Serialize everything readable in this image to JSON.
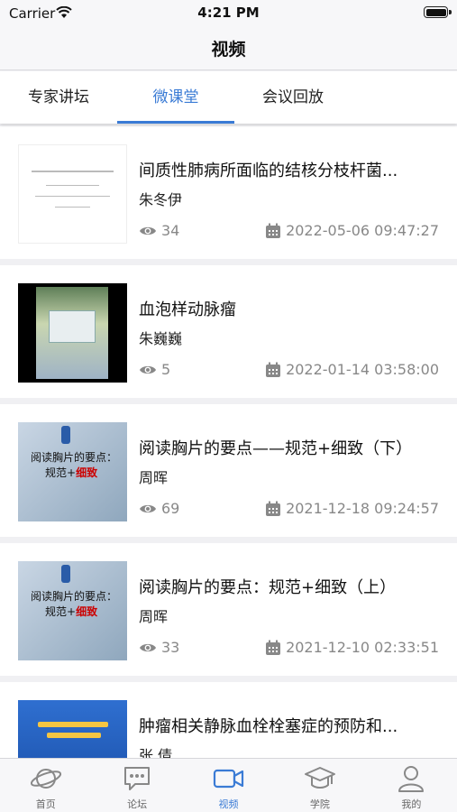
{
  "status_bar": {
    "carrier": "Carrier",
    "time": "4:21 PM"
  },
  "nav": {
    "title": "视频"
  },
  "tabs": [
    {
      "label": "专家讲坛",
      "active": false
    },
    {
      "label": "微课堂",
      "active": true
    },
    {
      "label": "会议回放",
      "active": false
    }
  ],
  "videos": [
    {
      "title": "间质性肺病所面临的结核分枝杆菌...",
      "author": "朱冬伊",
      "views": "34",
      "date": "2022-05-06 09:47:27",
      "thumb": "slide-text-white"
    },
    {
      "title": "血泡样动脉瘤",
      "author": "朱巍巍",
      "views": "5",
      "date": "2022-01-14 03:58:00",
      "thumb": "slide-building-photo"
    },
    {
      "title": "阅读胸片的要点——规范+细致（下）",
      "author": "周晖",
      "views": "69",
      "date": "2021-12-18 09:24:57",
      "thumb": "slide-blue-grey"
    },
    {
      "title": "阅读胸片的要点：规范+细致（上）",
      "author": "周晖",
      "views": "33",
      "date": "2021-12-10 02:33:51",
      "thumb": "slide-blue-grey"
    },
    {
      "title": "肿瘤相关静脉血栓栓塞症的预防和...",
      "author": "张 倩",
      "views": "",
      "date": "",
      "thumb": "slide-blue"
    }
  ],
  "thumb_text": {
    "slide3_line1": "阅读胸片的要点：",
    "slide3_line2_prefix": "规范+",
    "slide3_line2_red": "细致",
    "slide4_line1": "阅读胸片的要点：",
    "slide4_line2_prefix": "规范+",
    "slide4_line2_red": "细致"
  },
  "tabbar": [
    {
      "label": "首页",
      "icon": "planet-icon",
      "active": false
    },
    {
      "label": "论坛",
      "icon": "chat-bubble-icon",
      "active": false
    },
    {
      "label": "视频",
      "icon": "video-camera-icon",
      "active": true
    },
    {
      "label": "学院",
      "icon": "graduation-cap-icon",
      "active": false
    },
    {
      "label": "我的",
      "icon": "person-icon",
      "active": false
    }
  ],
  "colors": {
    "accent": "#3a7bd5",
    "meta_grey": "#888888",
    "background": "#f0f0f3"
  }
}
